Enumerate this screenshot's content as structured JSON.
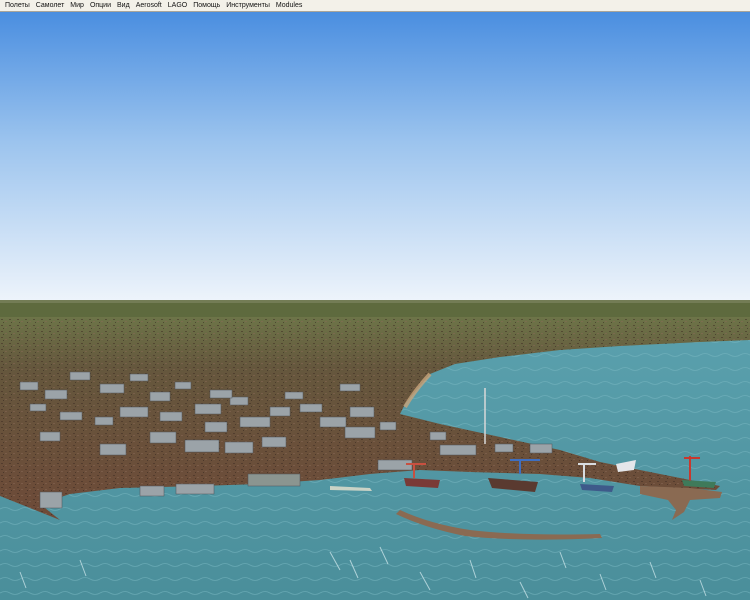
{
  "menu": {
    "items": [
      {
        "label": "Полеты"
      },
      {
        "label": "Самолет"
      },
      {
        "label": "Мир"
      },
      {
        "label": "Опции"
      },
      {
        "label": "Вид"
      },
      {
        "label": "Aerosoft"
      },
      {
        "label": "LAGO"
      },
      {
        "label": "Помощь"
      },
      {
        "label": "Инструменты"
      },
      {
        "label": "Modules"
      }
    ]
  },
  "scene": {
    "description_colors": {
      "sky_top": "#4a8fe0",
      "sky_horizon": "#eef4fb",
      "far_land": "#5f6a3e",
      "city_ground": "#6b4a38",
      "sea": "#5b9ca6",
      "sea_deep": "#3f8290",
      "pier": "#8a6a52"
    }
  }
}
